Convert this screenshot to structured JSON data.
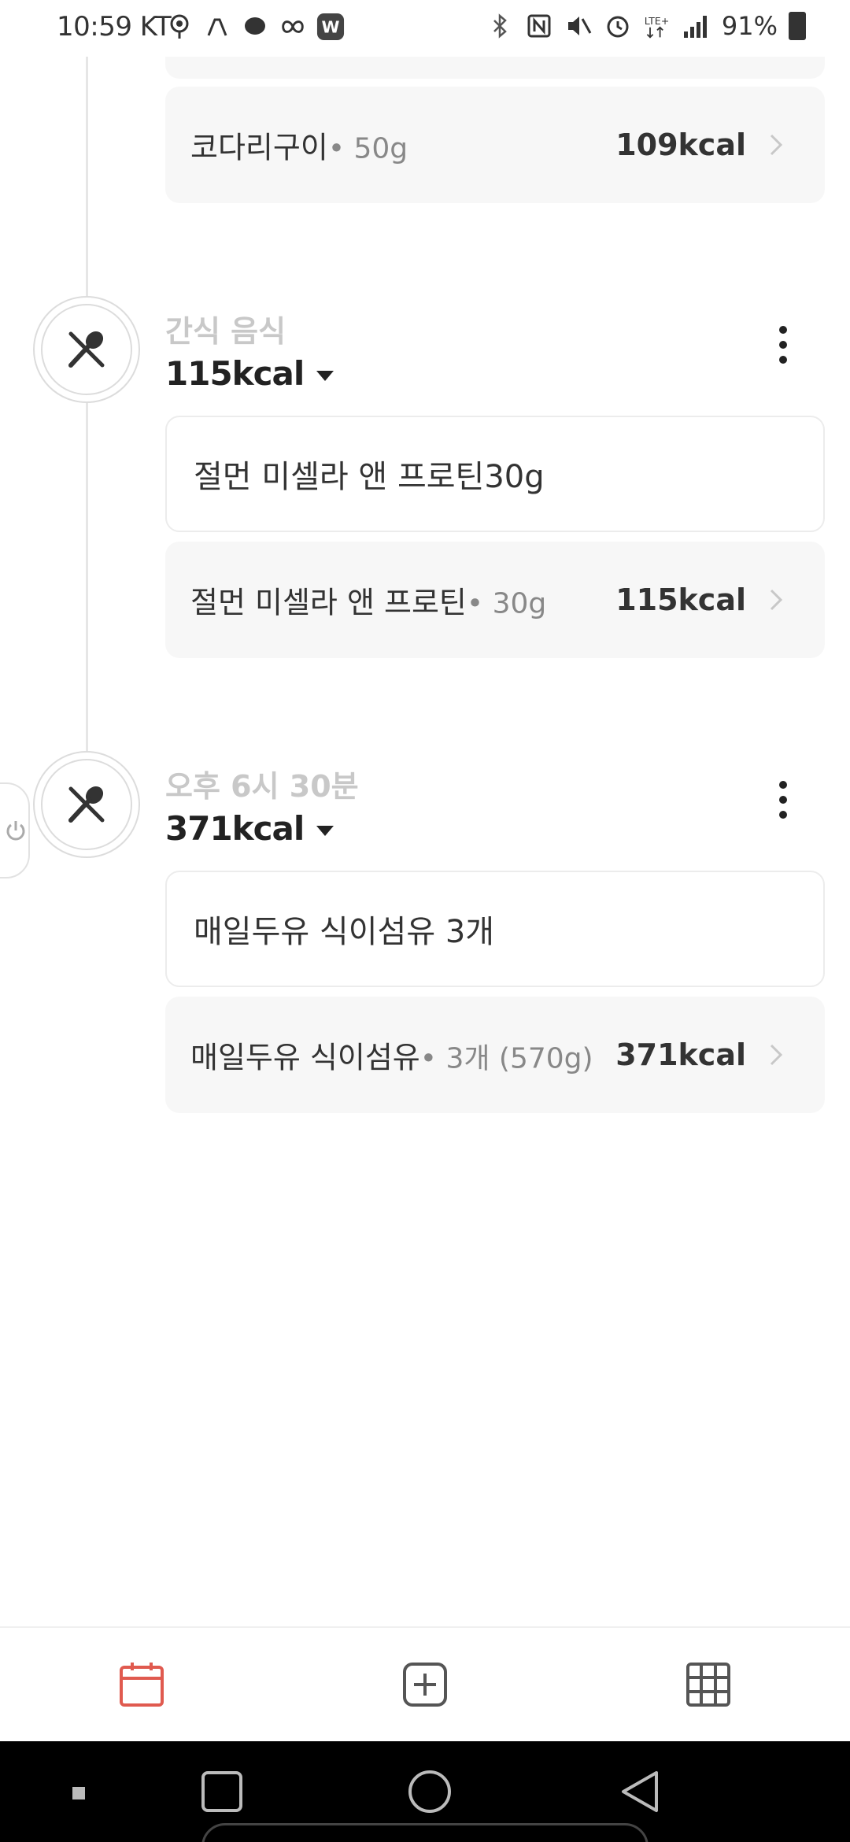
{
  "status_bar": {
    "time": "10:59",
    "carrier": "KT",
    "battery": "91%",
    "icons": [
      "map-pin-icon",
      "phone-icon",
      "chat-bubble-icon",
      "infinity-icon",
      "w-app-icon",
      "bluetooth-icon",
      "nfc-icon",
      "vibrate-icon",
      "alarm-icon",
      "lte-icon",
      "signal-icon",
      "battery-icon"
    ]
  },
  "top_item": {
    "name": "코다리구이",
    "amount": "• 50g",
    "kcal": "109kcal"
  },
  "meals": [
    {
      "label": "간식 음식",
      "kcal": "115kcal",
      "input_text": "절먼 미셀라 앤 프로틴30g",
      "item": {
        "name": "절먼 미셀라 앤 프로틴",
        "amount": "• 30g",
        "kcal": "115kcal"
      }
    },
    {
      "label": "오후 6시 30분",
      "kcal": "371kcal",
      "input_text": "매일두유 식이섬유 3개",
      "item": {
        "name": "매일두유 식이섬유",
        "amount": "• 3개 (570g)",
        "kcal": "371kcal"
      }
    }
  ],
  "bottom_nav": {
    "items": [
      "calendar-icon",
      "add-square-icon",
      "grid-icon"
    ],
    "accent_color": "#e05a4f"
  }
}
